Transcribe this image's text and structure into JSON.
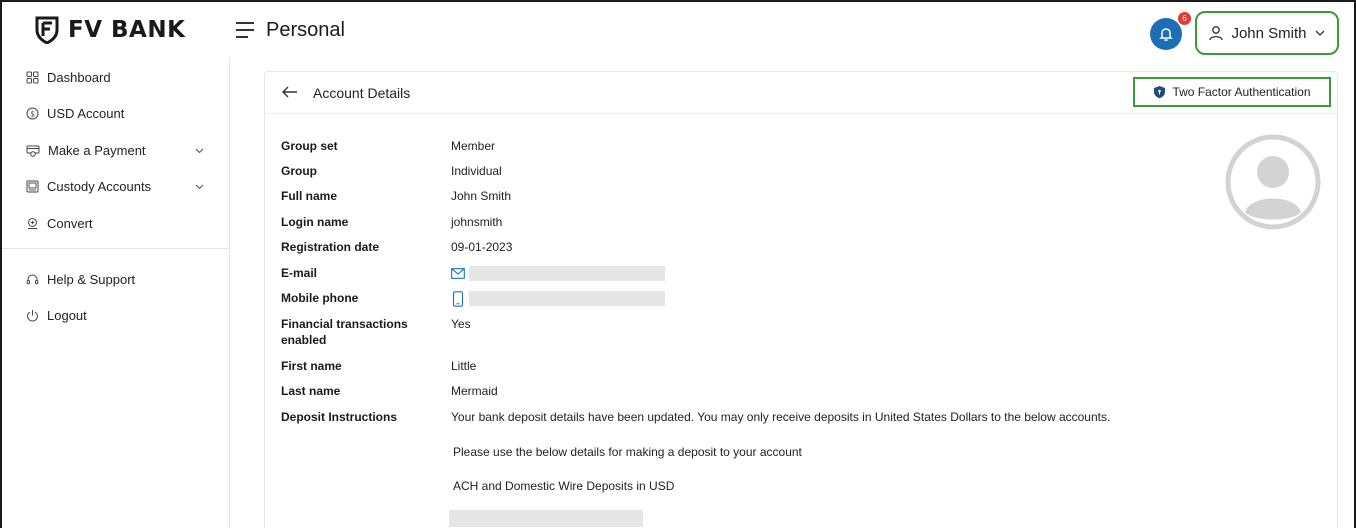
{
  "brand": {
    "name": "FV BANK"
  },
  "header": {
    "title": "Personal",
    "notification_count": "6",
    "user_name": "John Smith"
  },
  "sidebar": {
    "items": [
      {
        "label": "Dashboard",
        "icon": "grid-icon"
      },
      {
        "label": "USD Account",
        "icon": "dollar-coin-icon"
      },
      {
        "label": "Make a Payment",
        "icon": "payment-icon",
        "expandable": true
      },
      {
        "label": "Custody Accounts",
        "icon": "vault-icon",
        "expandable": true
      },
      {
        "label": "Convert",
        "icon": "convert-icon"
      }
    ],
    "footer_items": [
      {
        "label": "Help & Support",
        "icon": "headset-icon"
      },
      {
        "label": "Logout",
        "icon": "power-icon"
      }
    ]
  },
  "card": {
    "title": "Account Details",
    "tfa_label": "Two Factor Authentication",
    "details": [
      {
        "label": "Group set",
        "value": "Member"
      },
      {
        "label": "Group",
        "value": "Individual"
      },
      {
        "label": "Full name",
        "value": "John Smith"
      },
      {
        "label": "Login name",
        "value": "johnsmith"
      },
      {
        "label": "Registration date",
        "value": "09-01-2023"
      },
      {
        "label": "E-mail",
        "value": ""
      },
      {
        "label": "Mobile phone",
        "value": ""
      },
      {
        "label": "Financial transactions enabled",
        "value": "Yes"
      },
      {
        "label": "First name",
        "value": "Little"
      },
      {
        "label": "Last name",
        "value": "Mermaid"
      },
      {
        "label": "Deposit Instructions",
        "value": "Your bank deposit details have been updated. You may only receive deposits in United States Dollars to the below accounts."
      }
    ],
    "deposit_note_1": "Please use the below details for making a deposit to your account",
    "deposit_note_2": "ACH and Domestic Wire Deposits in USD"
  },
  "colors": {
    "accent_green": "#3a9b3a",
    "bell_blue": "#1c6fb5",
    "badge_red": "#e53935",
    "shield_navy": "#1f4c7a"
  }
}
